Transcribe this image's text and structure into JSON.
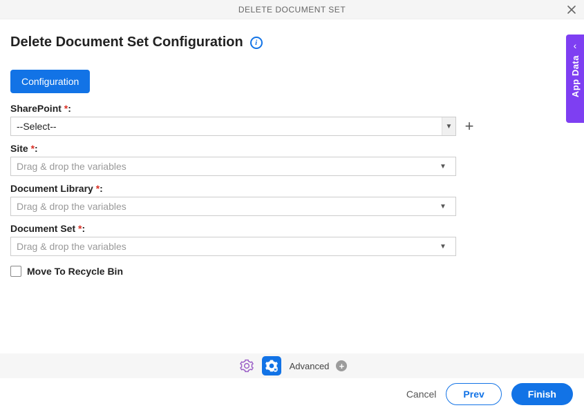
{
  "header": {
    "title": "DELETE DOCUMENT SET"
  },
  "page": {
    "title": "Delete Document Set Configuration"
  },
  "tabs": {
    "configuration": "Configuration"
  },
  "fields": {
    "sharepoint": {
      "label": "SharePoint ",
      "value": "--Select--"
    },
    "site": {
      "label": "Site ",
      "placeholder": "Drag & drop the variables"
    },
    "document_library": {
      "label": "Document Library ",
      "placeholder": "Drag & drop the variables"
    },
    "document_set": {
      "label": "Document Set ",
      "placeholder": "Drag & drop the variables"
    },
    "move_recycle": {
      "label": "Move To Recycle Bin"
    }
  },
  "toolbar": {
    "advanced_label": "Advanced"
  },
  "footer": {
    "cancel": "Cancel",
    "prev": "Prev",
    "finish": "Finish"
  },
  "side": {
    "label": "App Data"
  },
  "punctuation": {
    "required": "*",
    "colon": ":"
  }
}
